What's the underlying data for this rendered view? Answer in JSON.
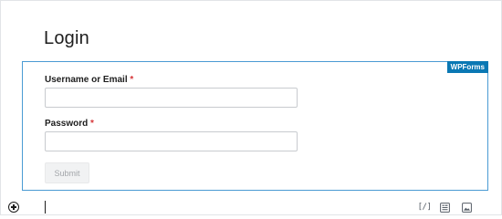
{
  "page": {
    "title": "Login"
  },
  "form": {
    "badge": "WPForms",
    "fields": [
      {
        "label": "Username or Email",
        "required_mark": "*",
        "value": "",
        "placeholder": ""
      },
      {
        "label": "Password",
        "required_mark": "*",
        "value": "",
        "placeholder": ""
      }
    ],
    "submit_label": "Submit"
  },
  "inserter": {
    "icons": [
      "add-block-icon",
      "shortcode-icon",
      "wpforms-icon",
      "image-icon"
    ],
    "shortcode_glyph": "[/]"
  },
  "colors": {
    "accent": "#0a78b4",
    "block_border": "#4a9bd3",
    "required": "#d63638"
  }
}
